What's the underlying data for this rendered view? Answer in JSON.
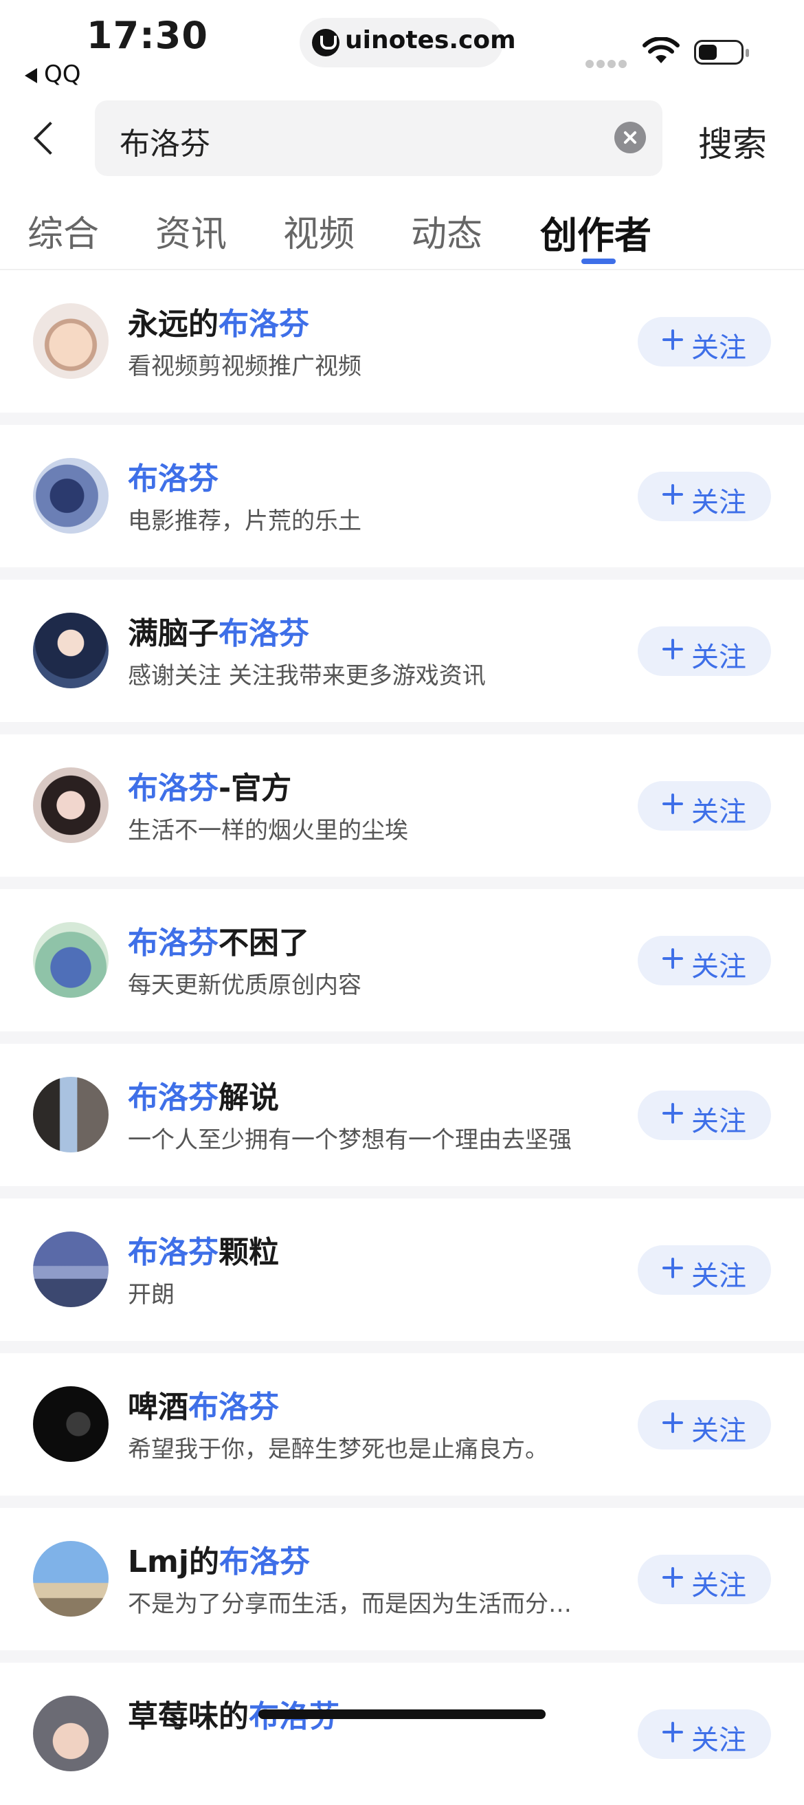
{
  "status_bar": {
    "time": "17:30",
    "back_app": "QQ",
    "url": "uinotes.com"
  },
  "search": {
    "query": "布洛芬",
    "search_label": "搜索"
  },
  "tabs": [
    {
      "label": "综合"
    },
    {
      "label": "资讯"
    },
    {
      "label": "视频"
    },
    {
      "label": "动态"
    },
    {
      "label": "创作者",
      "active": true
    }
  ],
  "follow_label": "关注",
  "results": [
    {
      "name_pre": "永远的",
      "name_hl": "布洛芬",
      "name_post": "",
      "desc": "看视频剪视频推广视频"
    },
    {
      "name_pre": "",
      "name_hl": "布洛芬",
      "name_post": "",
      "desc": "电影推荐，片荒的乐土"
    },
    {
      "name_pre": "满脑子",
      "name_hl": "布洛芬",
      "name_post": "",
      "desc": "感谢关注 关注我带来更多游戏资讯"
    },
    {
      "name_pre": "",
      "name_hl": "布洛芬",
      "name_post": "-官方",
      "desc": "生活不一样的烟火里的尘埃"
    },
    {
      "name_pre": "",
      "name_hl": "布洛芬",
      "name_post": "不困了",
      "desc": "每天更新优质原创内容"
    },
    {
      "name_pre": "",
      "name_hl": "布洛芬",
      "name_post": "解说",
      "desc": "一个人至少拥有一个梦想有一个理由去坚强"
    },
    {
      "name_pre": "",
      "name_hl": "布洛芬",
      "name_post": "颗粒",
      "desc": "开朗"
    },
    {
      "name_pre": "啤酒",
      "name_hl": "布洛芬",
      "name_post": "",
      "desc": "希望我于你，是醉生梦死也是止痛良方。"
    },
    {
      "name_pre": "Lmj的",
      "name_hl": "布洛芬",
      "name_post": "",
      "desc": "不是为了分享而生活，而是因为生活而分…"
    },
    {
      "name_pre": "草莓味的",
      "name_hl": "布洛芬",
      "name_post": "",
      "desc": ""
    }
  ],
  "colors": {
    "accent": "#3e6fe8",
    "follow_bg": "#ebf0fb",
    "separator": "#f5f5f7"
  }
}
